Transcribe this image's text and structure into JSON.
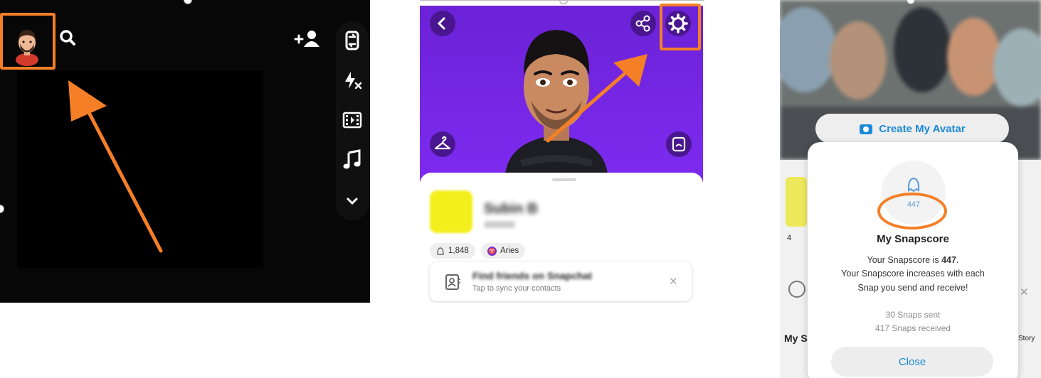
{
  "panel_camera": {
    "icons": [
      "bitmoji-avatar-icon",
      "search-icon",
      "add-friend-icon",
      "flip-camera-icon",
      "flash-off-icon",
      "video-icon",
      "music-icon",
      "chevron-down-icon"
    ],
    "highlight_color": "#f47f27"
  },
  "panel_profile": {
    "name": "Subin B",
    "username": "subinb",
    "score_badge": "1,848",
    "zodiac_badge": "Aries",
    "sync_title": "Find friends on Snapchat",
    "sync_subtitle": "Tap to sync your contacts",
    "dismiss": "✕",
    "banner_color": "#7d2bf0"
  },
  "panel_snapscore": {
    "create_avatar_label": "Create My Avatar",
    "score_value": "447",
    "title": "My Snapscore",
    "line1_prefix": "Your Snapscore is ",
    "line1_value": "447",
    "line1_suffix": ".",
    "line2": "Your Snapscore increases with each",
    "line3": "Snap you send and receive!",
    "sent": "30 Snaps sent",
    "received": "417 Snaps received",
    "close_label": "Close",
    "side_left_badge": "4",
    "side_my": "My S",
    "side_story": "Story",
    "side_close": "✕",
    "accent_color": "#1b8bd7"
  }
}
